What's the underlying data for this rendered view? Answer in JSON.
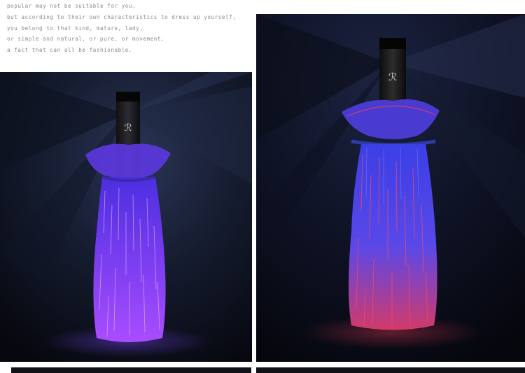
{
  "intro": {
    "lines": [
      "popular may not be suitable for you,",
      "but according to their own characteristics to dress up yourself,",
      "you belong to that kind, mature, lady,",
      "or simple and natural, or pure, or movement,",
      "a fact that can all be fashionable."
    ],
    "color": "#8a8a8a"
  },
  "photos": {
    "left": {
      "glow_color": "#9b4dff",
      "accent_color": "#c98bff",
      "subject": "bottle-bag-purple"
    },
    "right": {
      "glow_color": "#3a43ff",
      "accent_color": "#ff2a3c",
      "subject": "bottle-bag-red-blue"
    }
  }
}
